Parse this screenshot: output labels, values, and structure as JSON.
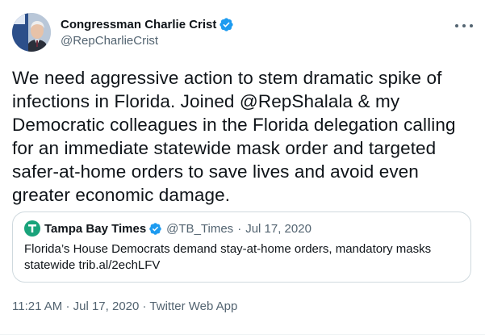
{
  "author": {
    "name": "Congressman Charlie Crist",
    "handle": "@RepCharlieCrist",
    "verified": true,
    "avatar_icon": "profile-photo"
  },
  "tweet": {
    "text": "We need aggressive action to stem dramatic spike of infections in Florida. Joined @RepShalala & my Democratic colleagues in the Florida delegation calling for an immediate statewide mask order and targeted safer-at-home orders to save lives and avoid even greater economic damage."
  },
  "quoted_tweet": {
    "name": "Tampa Bay Times",
    "handle": "@TB_Times",
    "separator": "·",
    "date": "Jul 17, 2020",
    "text": "Florida’s House Democrats demand stay-at-home orders, mandatory masks statewide trib.al/2echLFV",
    "logo_icon": "tampa-bay-times-logo"
  },
  "footer": {
    "time": "11:21 AM",
    "separator": "·",
    "date": "Jul 17, 2020",
    "source": "Twitter Web App"
  },
  "colors": {
    "verified_blue": "#1d9bf0",
    "text_primary": "#0f1419",
    "text_secondary": "#536471",
    "border": "#cfd9de",
    "tbt_green": "#19a37b"
  }
}
